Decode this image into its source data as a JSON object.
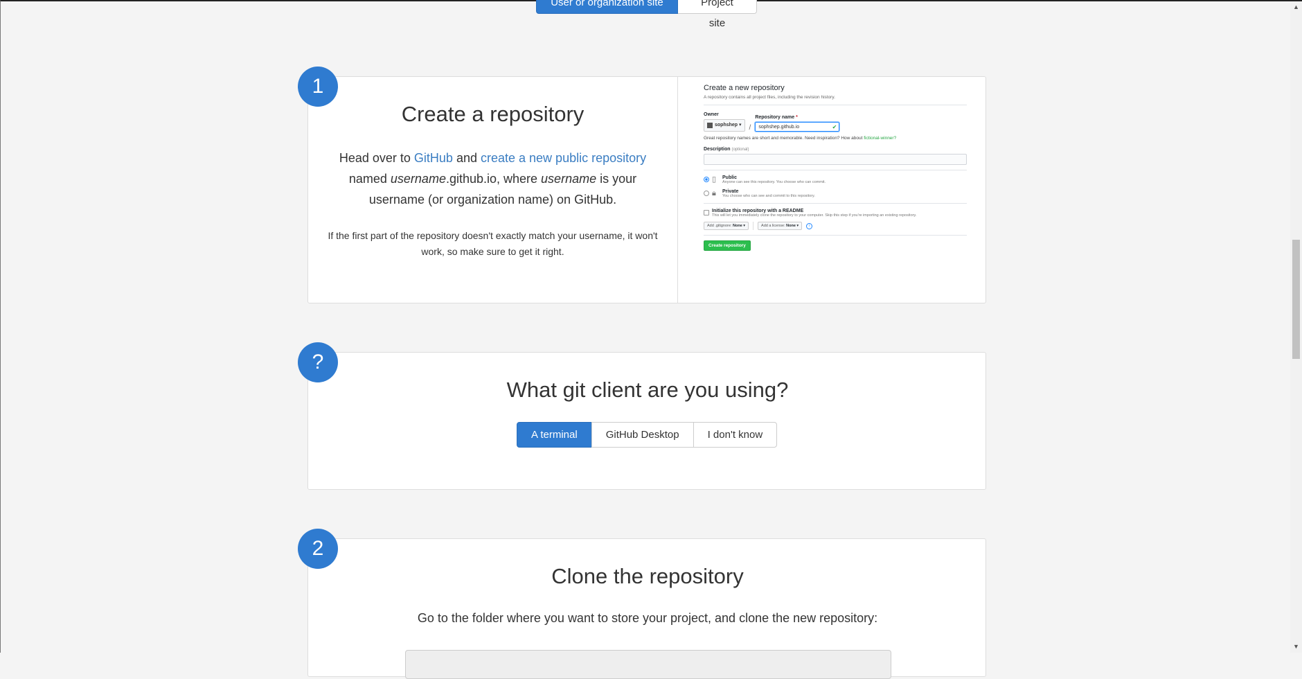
{
  "top_toggle": {
    "active_label": "User or organization site",
    "other_label": "Project site"
  },
  "step1": {
    "badge": "1",
    "title": "Create a repository",
    "lead_1": "Head over to ",
    "link_github": "GitHub",
    "lead_2": " and ",
    "link_create": "create a new public repository",
    "lead_3": " named ",
    "em_username_1": "username",
    "lead_4": ".github.io, where ",
    "em_username_2": "username",
    "lead_5": " is your username (or organization name) on GitHub.",
    "note": "If the first part of the repository doesn't exactly match your username, it won't work, so make sure to get it right.",
    "mock": {
      "title": "Create a new repository",
      "subtitle": "A repository contains all project files, including the revision history.",
      "owner_label": "Owner",
      "repo_label": "Repository name",
      "required_mark": "*",
      "owner_value": "sophshep ▾",
      "repo_value": "sophshep.github.io",
      "hint": "Great repository names are short and memorable. Need inspiration? How about ",
      "hint_suggestion": "fictional-winner?",
      "description_label": "Description",
      "description_optional": "(optional)",
      "public_label": "Public",
      "public_desc": "Anyone can see this repository. You choose who can commit.",
      "private_label": "Private",
      "private_desc": "You choose who can see and commit to this repository.",
      "init_label": "Initialize this repository with a README",
      "init_desc": "This will let you immediately clone the repository to your computer. Skip this step if you're importing an existing repository.",
      "gitignore_label": "Add .gitignore:",
      "gitignore_value": "None ▾",
      "license_label": "Add a license:",
      "license_value": "None ▾",
      "info_icon": "i",
      "create_button": "Create repository"
    }
  },
  "question": {
    "badge": "?",
    "title": "What git client are you using?",
    "options": [
      "A terminal",
      "GitHub Desktop",
      "I don't know"
    ]
  },
  "step2": {
    "badge": "2",
    "title": "Clone the repository",
    "lead": "Go to the folder where you want to store your project, and clone the new repository:"
  },
  "colors": {
    "accent": "#2f7bd0",
    "link": "#3a7dc2",
    "github_green": "#2cbe4e"
  }
}
